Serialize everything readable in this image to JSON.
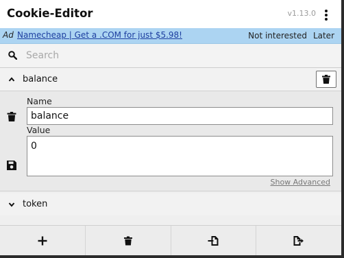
{
  "header": {
    "title": "Cookie-Editor",
    "version": "v1.13.0"
  },
  "ad": {
    "label": "Ad",
    "link_text": "Namecheap | Get a .COM for just $5.98!",
    "dismiss_label": "Not interested",
    "later_label": "Later"
  },
  "search": {
    "placeholder": "Search",
    "value": ""
  },
  "cookies": [
    {
      "name": "balance",
      "expanded": true,
      "fields": {
        "name_label": "Name",
        "name_value": "balance",
        "value_label": "Value",
        "value_value": "0",
        "show_advanced_label": "Show Advanced"
      }
    },
    {
      "name": "token",
      "expanded": false
    }
  ],
  "footer": {
    "buttons": [
      {
        "icon": "plus-icon"
      },
      {
        "icon": "trash-icon"
      },
      {
        "icon": "import-icon"
      },
      {
        "icon": "export-icon"
      }
    ]
  },
  "colors": {
    "ad_background": "#acd4f2",
    "ad_link": "#1d3fa0",
    "panel_background": "#efefef"
  }
}
